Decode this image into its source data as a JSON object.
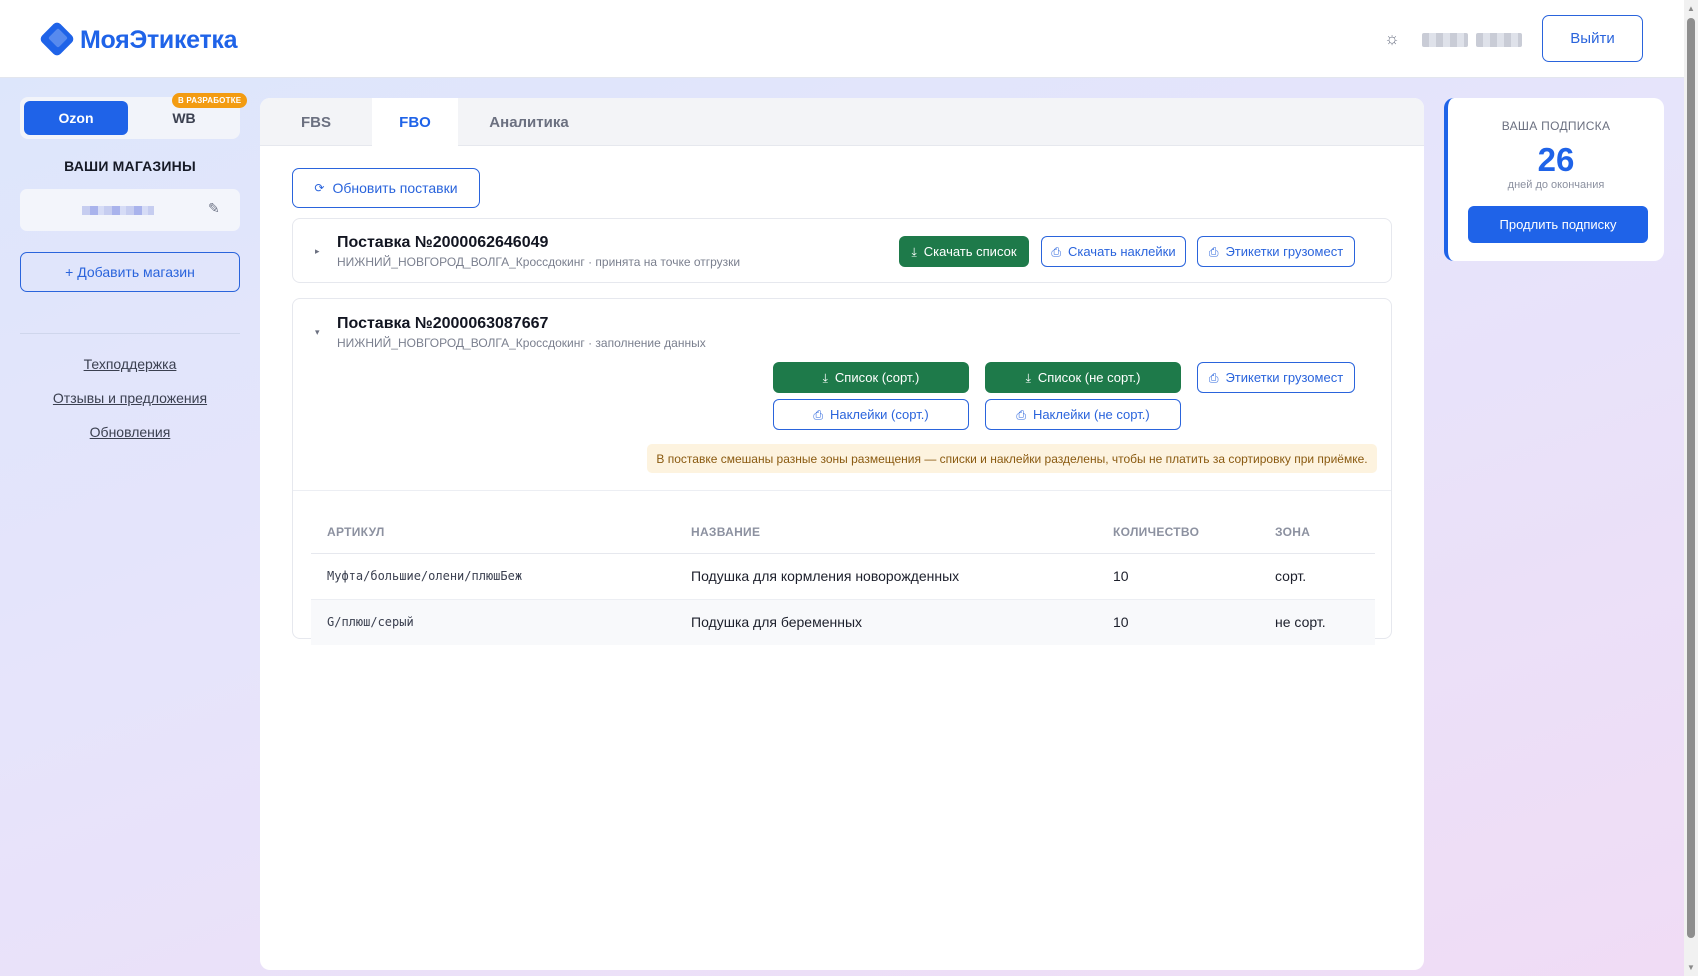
{
  "brand": {
    "name": "МояЭтикетка",
    "color": "#1f63e8"
  },
  "header": {
    "theme_icon": "sun-icon",
    "logout_label": "Выйти"
  },
  "marketplaces": {
    "tabs": [
      "Ozon",
      "WB"
    ],
    "active": "Ozon",
    "wb_badge": "В РАЗРАБОТКЕ"
  },
  "sidebar": {
    "stores_title": "ВАШИ МАГАЗИНЫ",
    "add_store_label": "+ Добавить магазин",
    "links": [
      "Техподдержка",
      "Отзывы и предложения",
      "Обновления"
    ]
  },
  "main": {
    "tabs": [
      "FBS",
      "FBO",
      "Аналитика"
    ],
    "active_tab": "FBO",
    "refresh_label": "Обновить поставки",
    "supplies": [
      {
        "title": "Поставка №2000062646049",
        "subtitle": "НИЖНИЙ_НОВГОРОД_ВОЛГА_Кроссдокинг · принята на точке отгрузки",
        "expanded": false,
        "buttons": {
          "download_list": "Скачать список",
          "download_labels": "Скачать наклейки",
          "cargo_labels": "Этикетки грузомест"
        }
      },
      {
        "title": "Поставка №2000063087667",
        "subtitle": "НИЖНИЙ_НОВГОРОД_ВОЛГА_Кроссдокинг · заполнение данных",
        "expanded": true,
        "buttons": {
          "list_sorted": "Список (сорт.)",
          "list_unsorted": "Список (не сорт.)",
          "cargo_labels": "Этикетки грузомест",
          "labels_sorted": "Наклейки (сорт.)",
          "labels_unsorted": "Наклейки (не сорт.)"
        },
        "note": "В поставке смешаны разные зоны размещения — списки и наклейки разделены, чтобы не платить за сортировку при приёмке.",
        "table": {
          "headers": [
            "АРТИКУЛ",
            "НАЗВАНИЕ",
            "КОЛИЧЕСТВО",
            "ЗОНА"
          ],
          "rows": [
            [
              "Муфта/большие/олени/плюшБеж",
              "Подушка для кормления новорожденных",
              "10",
              "сорт."
            ],
            [
              "G/плюш/серый",
              "Подушка для беременных",
              "10",
              "не сорт."
            ]
          ]
        }
      }
    ]
  },
  "subscription": {
    "label": "ВАША ПОДПИСКА",
    "days": "26",
    "days_label": "дней до окончания",
    "extend_label": "Продлить подписку"
  },
  "colors": {
    "accent": "#1f63e8",
    "success": "#1e7a4a",
    "warning_bg": "#fdf3df"
  }
}
